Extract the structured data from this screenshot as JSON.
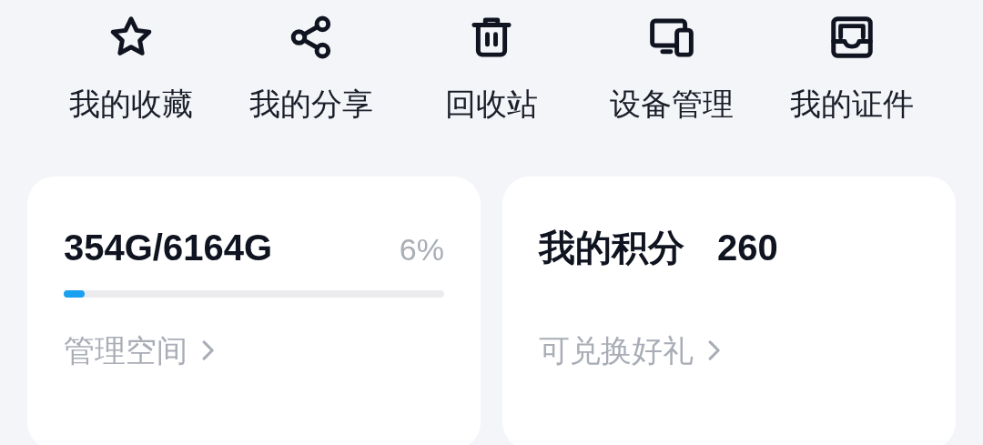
{
  "shortcuts": [
    {
      "kind": "star",
      "label": "我的收藏"
    },
    {
      "kind": "share",
      "label": "我的分享"
    },
    {
      "kind": "trash",
      "label": "回收站"
    },
    {
      "kind": "devices",
      "label": "设备管理"
    },
    {
      "kind": "tray",
      "label": "我的证件"
    }
  ],
  "storage": {
    "used": "354G/6164G",
    "percent": "6%",
    "level": 0.055,
    "link": "管理空间"
  },
  "points": {
    "label": "我的积分",
    "value": "260",
    "link": "可兑换好礼"
  }
}
